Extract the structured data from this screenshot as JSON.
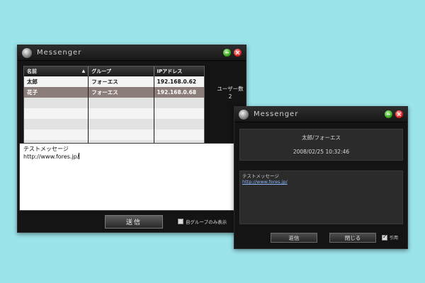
{
  "main_window": {
    "title": "Messenger",
    "table": {
      "headers": {
        "name": "名前",
        "group": "グループ",
        "ip": "IPアドレス",
        "sort_indicator": "▲"
      },
      "rows": [
        {
          "name": "太郎",
          "group": "フォ－エス",
          "ip": "192.168.0.62",
          "selected": false
        },
        {
          "name": "花子",
          "group": "フォーエス",
          "ip": "192.168.0.68",
          "selected": true
        }
      ]
    },
    "user_count_label": "ユーザー数",
    "user_count_value": "2",
    "message_line1": "テストメッセージ",
    "message_line2": "http://www.fores.jp/",
    "send_label": "送信",
    "own_group_only_label": "自グループのみ表示",
    "own_group_only_checked": false
  },
  "receive_window": {
    "title": "Messenger",
    "sender": "太郎/フォーエス",
    "timestamp": "2008/02/25 10:32:46",
    "message_line1": "テストメッセージ",
    "message_link": "http://www.fores.jp/",
    "reply_label": "返信",
    "close_label": "閉じる",
    "quote_label": "引用",
    "quote_checked": true
  },
  "colors": {
    "background": "#9be4ea",
    "window": "#141414",
    "selected_row": "#8b7d7a",
    "link": "#8fb6ff"
  },
  "icons": {
    "app": "messenger-app-icon",
    "minimize": "minimize-icon",
    "close": "close-icon"
  }
}
